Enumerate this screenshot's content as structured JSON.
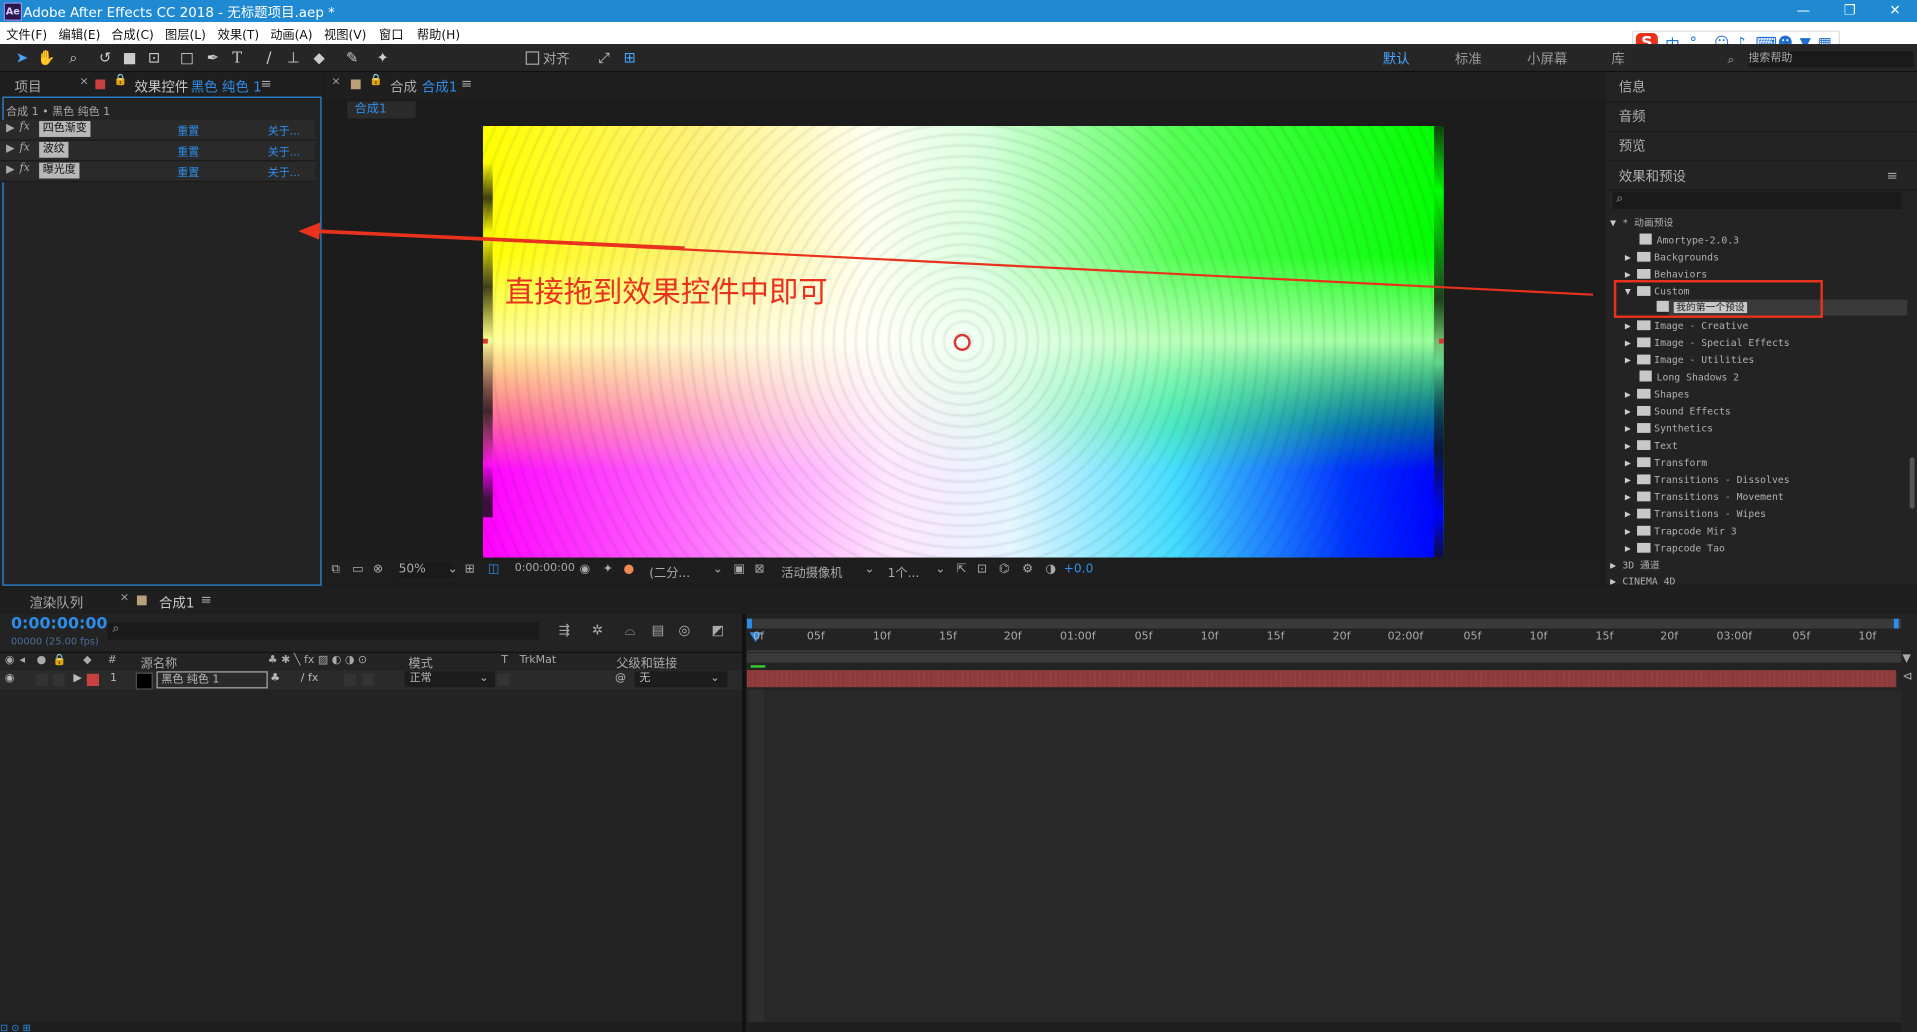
{
  "window": {
    "title": "Adobe After Effects CC 2018 - 无标题项目.aep *",
    "app_badge": "Ae",
    "minimize": "—",
    "restore": "❐",
    "close": "✕"
  },
  "menu": [
    "文件(F)",
    "编辑(E)",
    "合成(C)",
    "图层(L)",
    "效果(T)",
    "动画(A)",
    "视图(V)",
    "窗口",
    "帮助(H)"
  ],
  "toolbar": {
    "snap_label": "对齐",
    "workspaces": [
      "默认",
      "标准",
      "小屏幕",
      "库"
    ],
    "active_workspace": "默认",
    "search_help": "搜索帮助"
  },
  "left_panel": {
    "tab_project": "项目",
    "tab_effects": "效果控件",
    "tab_effects_layer": "黑色 纯色 1",
    "breadcrumb": "合成 1 • 黑色 纯色 1",
    "effects": [
      {
        "fx": "fx",
        "name": "四色渐变",
        "reset": "重置",
        "about": "关于..."
      },
      {
        "fx": "fx",
        "name": "波纹",
        "reset": "重置",
        "about": "关于..."
      },
      {
        "fx": "fx",
        "name": "曝光度",
        "reset": "重置",
        "about": "关于..."
      }
    ]
  },
  "comp_panel": {
    "tab_label": "合成",
    "tab_name": "合成1",
    "subtab": "合成1",
    "annotation": "直接拖到效果控件中即可",
    "footer": {
      "zoom": "50%",
      "timecode": "0:00:00:00",
      "resolution": "(二分...",
      "camera": "活动摄像机",
      "views": "1个...",
      "exposure": "+0.0"
    }
  },
  "right_panel": {
    "tabs": [
      "信息",
      "音频",
      "预览",
      "效果和预设"
    ],
    "tree": [
      {
        "kind": "root",
        "label": "* 动画预设",
        "open": true
      },
      {
        "kind": "preset",
        "label": "Amortype-2.0.3"
      },
      {
        "kind": "folder",
        "label": "Backgrounds"
      },
      {
        "kind": "folder",
        "label": "Behaviors"
      },
      {
        "kind": "folder",
        "label": "Custom",
        "open": true
      },
      {
        "kind": "preset-sel",
        "label": "我的第一个预设"
      },
      {
        "kind": "folder",
        "label": "Image - Creative"
      },
      {
        "kind": "folder",
        "label": "Image - Special Effects"
      },
      {
        "kind": "folder",
        "label": "Image - Utilities"
      },
      {
        "kind": "preset",
        "label": "Long Shadows 2"
      },
      {
        "kind": "folder",
        "label": "Shapes"
      },
      {
        "kind": "folder",
        "label": "Sound Effects"
      },
      {
        "kind": "folder",
        "label": "Synthetics"
      },
      {
        "kind": "folder",
        "label": "Text"
      },
      {
        "kind": "folder",
        "label": "Transform"
      },
      {
        "kind": "folder",
        "label": "Transitions - Dissolves"
      },
      {
        "kind": "folder",
        "label": "Transitions - Movement"
      },
      {
        "kind": "folder",
        "label": "Transitions - Wipes"
      },
      {
        "kind": "folder",
        "label": "Trapcode Mir 3"
      },
      {
        "kind": "folder",
        "label": "Trapcode Tao"
      },
      {
        "kind": "root2",
        "label": "3D 通道"
      },
      {
        "kind": "root2",
        "label": "CINEMA 4D"
      }
    ]
  },
  "timeline": {
    "tab_render": "渲染队列",
    "tab_comp": "合成1",
    "timecode": "0:00:00:00",
    "fps": "00000 (25.00 fps)",
    "col_source": "源名称",
    "col_hash": "#",
    "col_mode": "模式",
    "col_t": "T",
    "col_trkmat": "TrkMat",
    "col_parent": "父级和链接",
    "layer": {
      "index": "1",
      "name": "黑色 纯色 1",
      "mode": "正常",
      "parent": "无"
    },
    "ruler": [
      "0f",
      "05f",
      "10f",
      "15f",
      "20f",
      "01:00f",
      "05f",
      "10f",
      "15f",
      "20f",
      "02:00f",
      "05f",
      "10f",
      "15f",
      "20f",
      "03:00f",
      "05f",
      "10f"
    ]
  },
  "colors": {
    "accent_blue": "#2e8de8",
    "title_bar": "#1f8ad2",
    "annotation_red": "#e8321e",
    "layer_bar": "#8e3a3a"
  }
}
